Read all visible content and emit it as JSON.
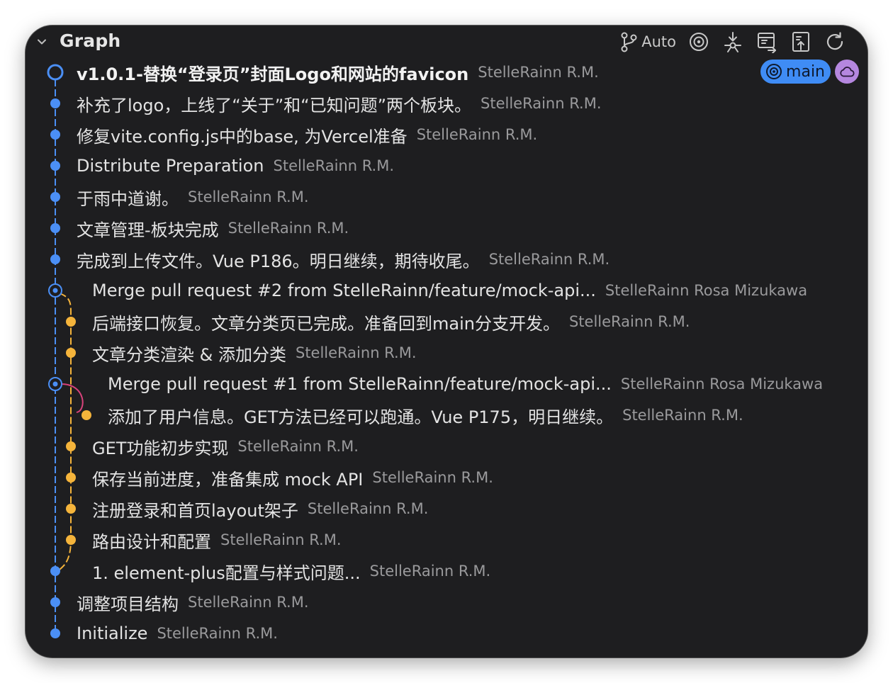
{
  "header": {
    "title": "Graph",
    "auto_label": "Auto",
    "icons": [
      "chevron-down-icon",
      "branch-icon",
      "target-icon",
      "fetch-icon",
      "push-icon",
      "pull-icon",
      "refresh-icon"
    ]
  },
  "colors": {
    "panel_bg": "#1e1e20",
    "main_lane": "#4b8ff5",
    "feature_lane": "#f5b43b",
    "merge_lane": "#d9437c",
    "branch_badge": "#3f8cf5",
    "remote_badge": "#b587df"
  },
  "badges": {
    "branch": "main",
    "branch_icon": "target-icon",
    "remote_icon": "cloud-icon"
  },
  "commits": [
    {
      "message": "v1.0.1-替换“登录页”封面Logo和网站的favicon",
      "author": "StelleRainn R.M.",
      "head": true
    },
    {
      "message": "补充了logo，上线了“关于”和“已知问题”两个板块。",
      "author": "StelleRainn R.M."
    },
    {
      "message": "修复vite.config.js中的base, 为Vercel准备",
      "author": "StelleRainn R.M."
    },
    {
      "message": "Distribute Preparation",
      "author": "StelleRainn R.M."
    },
    {
      "message": "于雨中道谢。",
      "author": "StelleRainn R.M."
    },
    {
      "message": "文章管理-板块完成",
      "author": "StelleRainn R.M."
    },
    {
      "message": "完成到上传文件。Vue P186。明日继续，期待收尾。",
      "author": "StelleRainn R.M."
    },
    {
      "message": "Merge pull request #2 from StelleRainn/feature/mock-api...",
      "author": "StelleRainn Rosa Mizukawa",
      "merge": true
    },
    {
      "message": "后端接口恢复。文章分类页已完成。准备回到main分支开发。",
      "author": "StelleRainn R.M."
    },
    {
      "message": "文章分类渲染 & 添加分类",
      "author": "StelleRainn R.M."
    },
    {
      "message": "Merge pull request #1 from StelleRainn/feature/mock-api...",
      "author": "StelleRainn Rosa Mizukawa",
      "merge": true
    },
    {
      "message": "添加了用户信息。GET方法已经可以跑通。Vue P175，明日继续。",
      "author": "StelleRainn R.M."
    },
    {
      "message": "GET功能初步实现",
      "author": "StelleRainn R.M."
    },
    {
      "message": "保存当前进度，准备集成 mock API",
      "author": "StelleRainn R.M."
    },
    {
      "message": "注册登录和首页layout架子",
      "author": "StelleRainn R.M."
    },
    {
      "message": "路由设计和配置",
      "author": "StelleRainn R.M."
    },
    {
      "message": "1. element-plus配置与样式问题...",
      "author": "StelleRainn R.M."
    },
    {
      "message": "调整项目结构",
      "author": "StelleRainn R.M."
    },
    {
      "message": "Initialize",
      "author": "StelleRainn R.M."
    }
  ]
}
